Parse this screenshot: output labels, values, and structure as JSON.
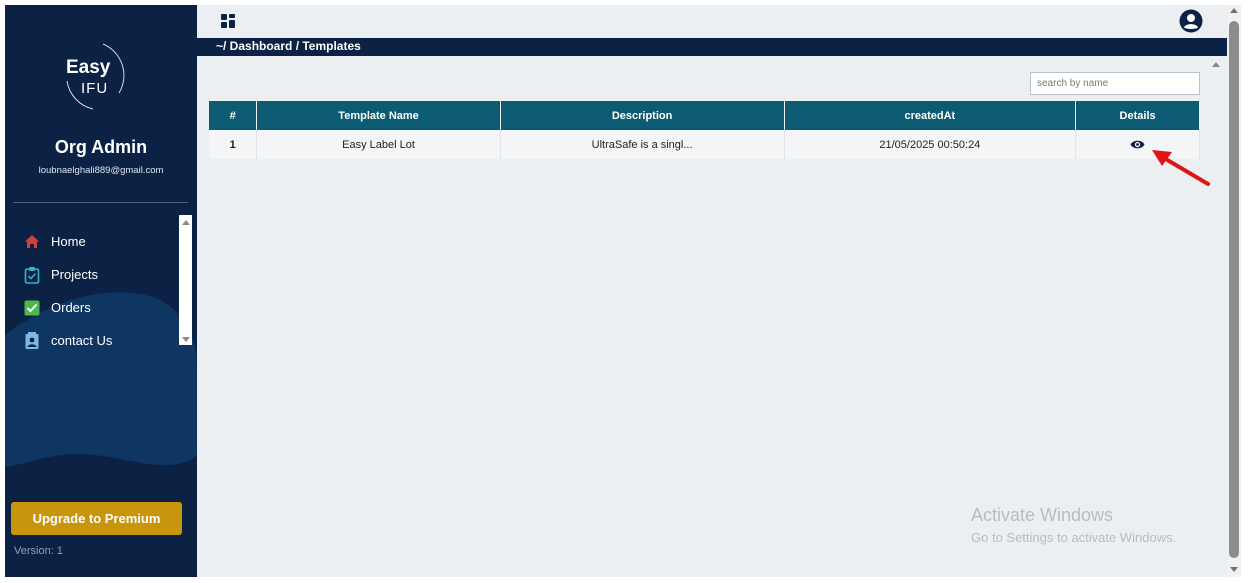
{
  "sidebar": {
    "logo_line1": "Easy",
    "logo_line2": "IFU",
    "org_name": "Org Admin",
    "org_email": "loubnaelghali889@gmail.com",
    "nav": [
      {
        "label": "Home",
        "icon": "home-icon"
      },
      {
        "label": "Projects",
        "icon": "clipboard-icon"
      },
      {
        "label": "Orders",
        "icon": "check-shield-icon"
      },
      {
        "label": "contact Us",
        "icon": "contact-card-icon"
      }
    ],
    "upgrade_label": "Upgrade to Premium",
    "version": "Version: 1"
  },
  "header": {
    "breadcrumb": "~/ Dashboard / Templates"
  },
  "search": {
    "placeholder": "search by name"
  },
  "table": {
    "columns": [
      "#",
      "Template Name",
      "Description",
      "createdAt",
      "Details"
    ],
    "rows": [
      {
        "num": "1",
        "name": "Easy Label Lot",
        "description": "UltraSafe is a singl...",
        "created_at": "21/05/2025 00:50:24",
        "details_icon": "eye-icon"
      }
    ]
  },
  "watermark": {
    "line1": "Activate Windows",
    "line2": "Go to Settings to activate Windows."
  },
  "colors": {
    "sidebar_bg": "#0b2244",
    "table_header": "#0d5a73",
    "upgrade_button": "#c8960c",
    "annotation_arrow": "#e01414"
  }
}
